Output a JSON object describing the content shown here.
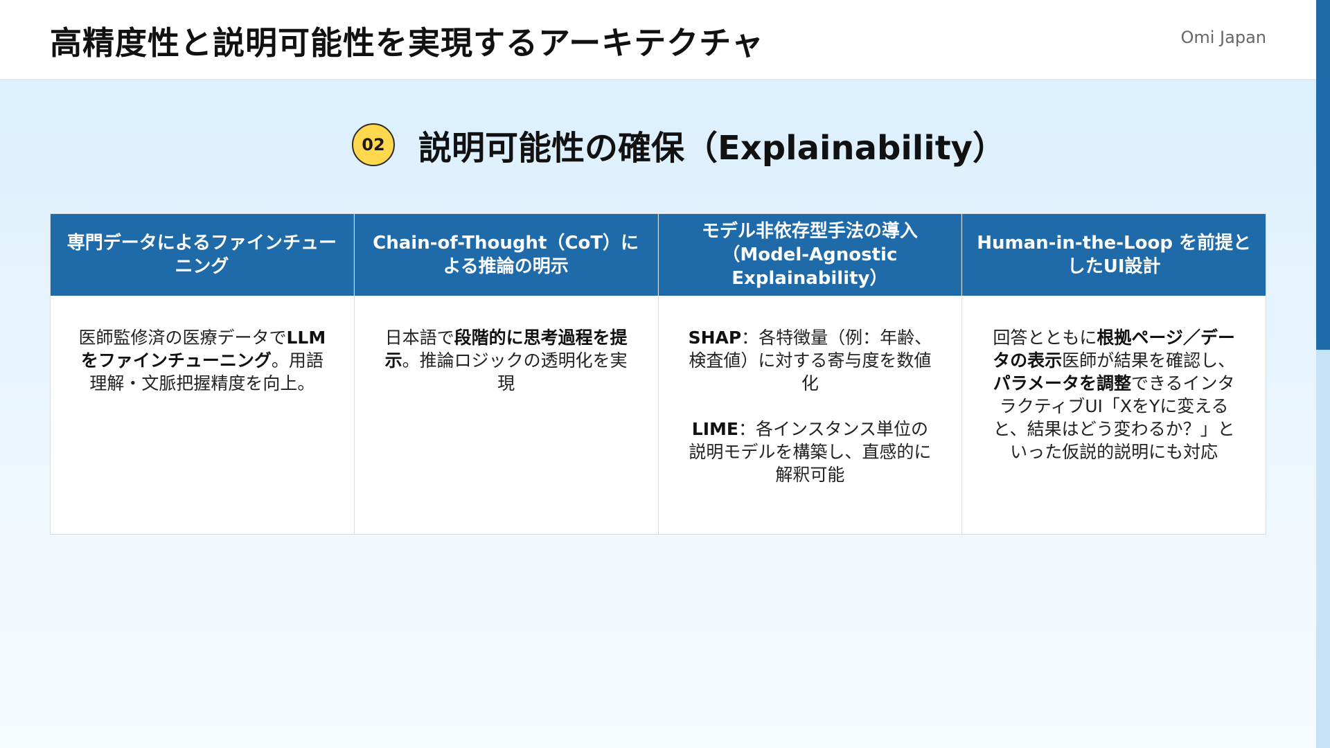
{
  "header": {
    "title": "高精度性と説明可能性を実現するアーキテクチャ",
    "brand": "Omi Japan"
  },
  "section": {
    "number": "02",
    "title": "説明可能性の確保（Explainability）"
  },
  "columns": [
    {
      "heading": "専門データによるファインチューニング",
      "paragraphs": [
        [
          {
            "text": "医師監修済の医療データで",
            "bold": false
          },
          {
            "text": "LLMをファインチューニング",
            "bold": true
          },
          {
            "text": "。用語理解・文脈把握精度を向上。",
            "bold": false
          }
        ]
      ]
    },
    {
      "heading": "Chain-of-Thought（CoT）による推論の明示",
      "paragraphs": [
        [
          {
            "text": "日本語で",
            "bold": false
          },
          {
            "text": "段階的に思考過程を提示",
            "bold": true
          },
          {
            "text": "。推論ロジックの透明化を実現",
            "bold": false
          }
        ]
      ]
    },
    {
      "heading": "モデル非依存型手法の導入（Model-Agnostic Explainability）",
      "paragraphs": [
        [
          {
            "text": "SHAP",
            "bold": true
          },
          {
            "text": "：各特徴量（例：年齢、検査値）に対する寄与度を数値化",
            "bold": false
          }
        ],
        [
          {
            "text": "LIME",
            "bold": true
          },
          {
            "text": "：各インスタンス単位の説明モデルを構築し、直感的に解釈可能",
            "bold": false
          }
        ]
      ]
    },
    {
      "heading": "Human-in-the-Loop を前提としたUI設計",
      "paragraphs": [
        [
          {
            "text": "回答とともに",
            "bold": false
          },
          {
            "text": "根拠ページ／データの表示",
            "bold": true
          },
          {
            "text": "医師が結果を確認し、",
            "bold": false
          },
          {
            "text": "パラメータを調整",
            "bold": true
          },
          {
            "text": "できるインタラクティブUI「XをYに変えると、結果はどう変わるか？」といった仮説的説明にも対応",
            "bold": false
          }
        ]
      ]
    }
  ],
  "colors": {
    "header_blue": "#1f6aa8",
    "badge_yellow": "#ffd84d",
    "background_top": "#dbeffd"
  }
}
